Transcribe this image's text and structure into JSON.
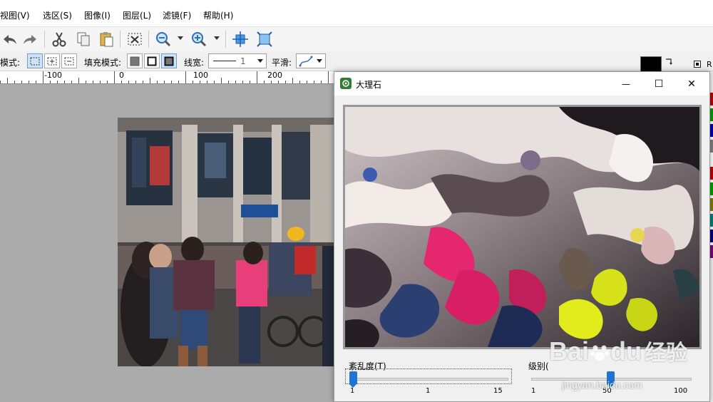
{
  "menu": [
    {
      "label": "视图(V)"
    },
    {
      "label": "选区(S)"
    },
    {
      "label": "图像(I)"
    },
    {
      "label": "图层(L)"
    },
    {
      "label": "滤镜(F)"
    },
    {
      "label": "帮助(H)"
    }
  ],
  "toolbar": {
    "icons": [
      "undo-icon",
      "redo-icon",
      "cut-icon",
      "copy-icon",
      "paste-icon",
      "deselect-icon",
      "zoom-out-icon",
      "zoom-in-icon",
      "crosshair-icon",
      "fit-window-icon"
    ]
  },
  "modebar": {
    "select_mode_label": "模式:",
    "fill_mode_label": "填充模式:",
    "line_width_label": "线宽:",
    "line_width_value": "1",
    "smooth_label": "平滑:"
  },
  "ruler": {
    "labels": [
      "-100",
      "0",
      "100",
      "200"
    ]
  },
  "right_panel": {
    "partial_label": "R"
  },
  "dialog": {
    "title": "大理石",
    "minimize": "—",
    "maximize": "☐",
    "close": "✕",
    "turbulence": {
      "label": "紊乱度(T)",
      "min": "1",
      "mid": "1",
      "max": "15",
      "value": 1
    },
    "level": {
      "label": "级别(",
      "min": "1",
      "mid": "50",
      "max": "100",
      "value": 50
    }
  },
  "watermark": {
    "brand": "Bai",
    "brand2": "du",
    "cn": "经验",
    "url": "jingyan.baidu.com"
  },
  "colors": {
    "accent": "#1f74d2",
    "palette": [
      "#c00000",
      "#00a000",
      "#0000c0",
      "#7f7f7f",
      "#c00000",
      "#7f7f00",
      "#007f7f",
      "#00007f",
      "#7f007f"
    ]
  }
}
